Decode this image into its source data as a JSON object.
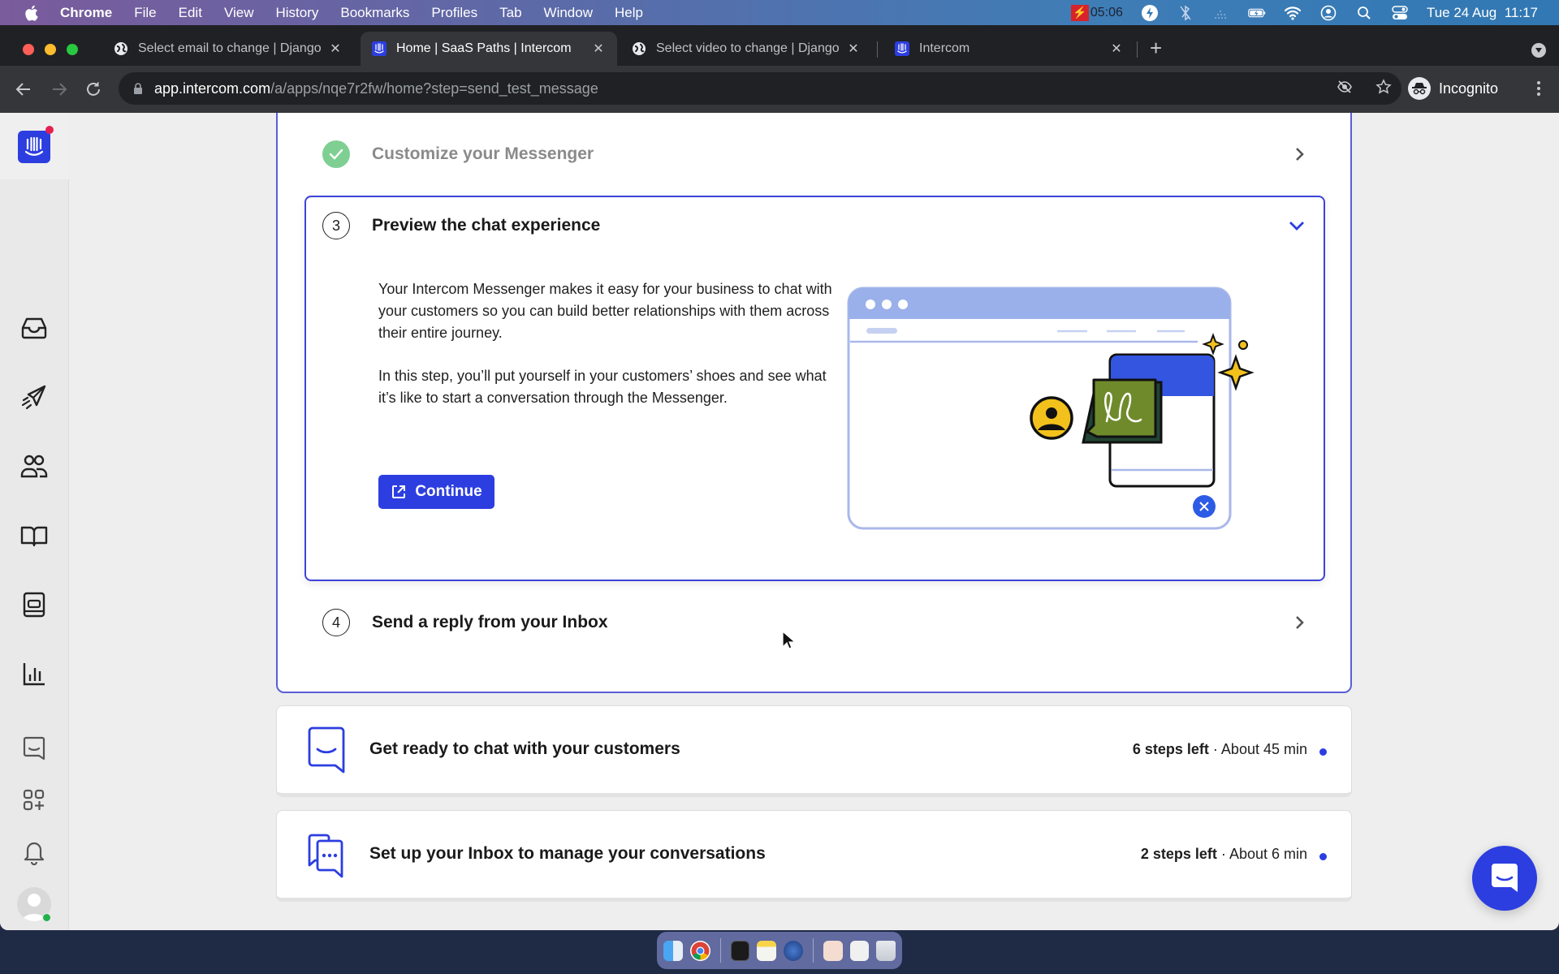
{
  "menubar": {
    "app_name": "Chrome",
    "items": [
      "File",
      "Edit",
      "View",
      "History",
      "Bookmarks",
      "Profiles",
      "Tab",
      "Window",
      "Help"
    ],
    "recording_time": "05:06",
    "datetime": "Tue 24 Aug  11:17"
  },
  "browser": {
    "tabs": [
      {
        "title": "Select email to change | Django",
        "favicon": "globe-icon",
        "active": false
      },
      {
        "title": "Home | SaaS Paths | Intercom",
        "favicon": "intercom-icon",
        "active": true
      },
      {
        "title": "Select video to change | Django",
        "favicon": "globe-icon",
        "active": false
      },
      {
        "title": "Intercom",
        "favicon": "intercom-icon",
        "active": false
      }
    ],
    "close_glyph": "✕",
    "new_tab_glyph": "+",
    "url_host": "app.intercom.com",
    "url_path": "/a/apps/nqe7r2fw/home?step=send_test_message",
    "profile_label": "Incognito"
  },
  "sidebar": {
    "items": [
      {
        "name": "inbox",
        "icon": "inbox-icon"
      },
      {
        "name": "outbound",
        "icon": "paper-plane-icon"
      },
      {
        "name": "contacts",
        "icon": "people-icon"
      },
      {
        "name": "articles",
        "icon": "book-icon"
      },
      {
        "name": "messenger",
        "icon": "messenger-icon"
      },
      {
        "name": "reports",
        "icon": "bar-chart-icon"
      },
      {
        "name": "conversations",
        "icon": "chat-icon"
      },
      {
        "name": "apps",
        "icon": "app-grid-icon"
      },
      {
        "name": "notifications",
        "icon": "bell-icon"
      }
    ]
  },
  "checklist": {
    "steps": [
      {
        "status": "done",
        "title": "Customize your Messenger"
      },
      {
        "status": "active",
        "number": "3",
        "title": "Preview the chat experience",
        "paragraphs": [
          "Your Intercom Messenger makes it easy for your business to chat with your customers so you can build better relationships with them across their entire journey.",
          "In this step, you’ll put yourself in your customers’ shoes and see what it’s like to start a conversation through the Messenger."
        ],
        "button_label": "Continue"
      },
      {
        "status": "pending",
        "number": "4",
        "title": "Send a reply from your Inbox"
      }
    ]
  },
  "paths": [
    {
      "title": "Get ready to chat with your customers",
      "steps_left": "6 steps left",
      "separator": " · ",
      "duration": "About 45 min",
      "icon": "chat-smile-icon"
    },
    {
      "title": "Set up your Inbox to manage your conversations",
      "steps_left": "2 steps left",
      "separator": " · ",
      "duration": "About 6 min",
      "icon": "chat-bubbles-icon"
    }
  ],
  "colors": {
    "brand": "#2c3ee0",
    "success": "#7fcf93",
    "border_active": "#3d43d8"
  }
}
